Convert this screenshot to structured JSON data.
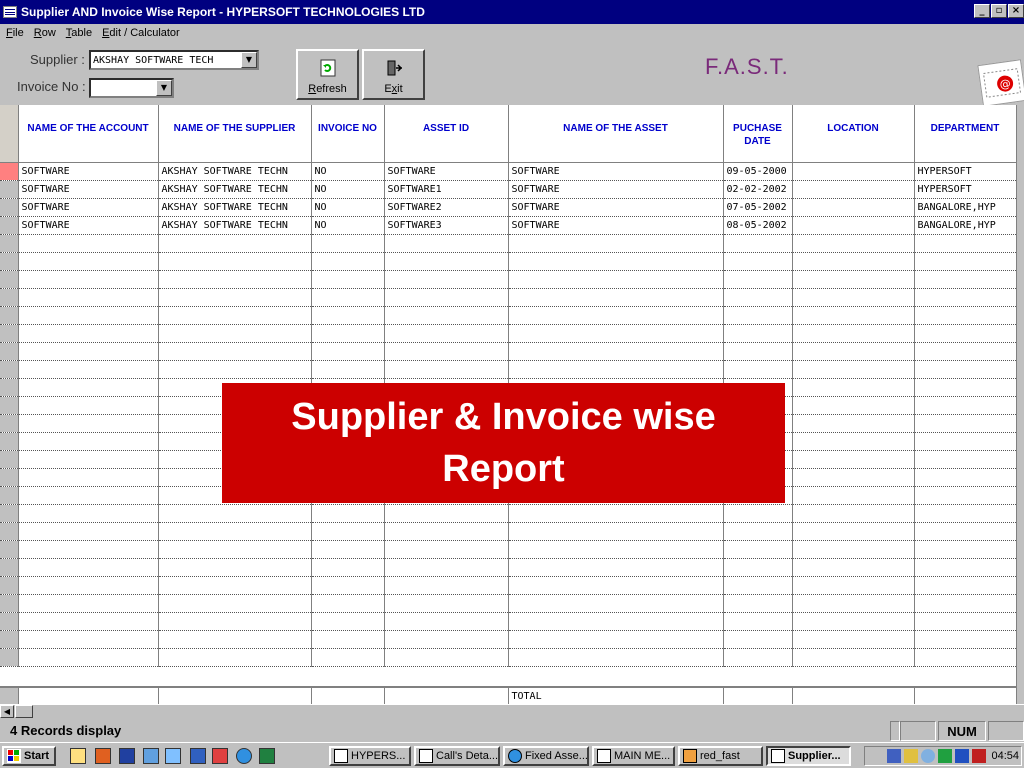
{
  "window": {
    "title": "Supplier AND Invoice Wise Report  -  HYPERSOFT TECHNOLOGIES LTD",
    "controls": [
      "_",
      "▫",
      "×"
    ]
  },
  "menu": [
    {
      "key": "F",
      "rest": "ile"
    },
    {
      "key": "R",
      "rest": "ow"
    },
    {
      "key": "T",
      "rest": "able"
    },
    {
      "key": "E",
      "rest": "dit / Calculator"
    }
  ],
  "filters": {
    "supplier_label": "Supplier :",
    "supplier_value": "AKSHAY SOFTWARE TECH",
    "invoice_label": "Invoice No :",
    "invoice_value": ""
  },
  "toolbar": {
    "refresh_key": "R",
    "refresh_rest": "efresh",
    "exit_pre": "E",
    "exit_key": "x",
    "exit_rest": "it"
  },
  "brand": "F.A.S.T.",
  "table": {
    "columns": [
      "NAME OF THE ACCOUNT",
      "NAME OF THE SUPPLIER",
      "INVOICE NO",
      "ASSET ID",
      "NAME OF THE ASSET",
      "PUCHASE DATE",
      "LOCATION",
      "DEPARTMENT"
    ],
    "rows": [
      [
        "SOFTWARE",
        "AKSHAY SOFTWARE TECHN",
        "NO",
        "SOFTWARE",
        "SOFTWARE",
        "09-05-2000",
        "",
        "HYPERSOFT"
      ],
      [
        "SOFTWARE",
        "AKSHAY SOFTWARE TECHN",
        "NO",
        "SOFTWARE1",
        "SOFTWARE",
        "02-02-2002",
        "",
        "HYPERSOFT"
      ],
      [
        "SOFTWARE",
        "AKSHAY SOFTWARE TECHN",
        "NO",
        "SOFTWARE2",
        "SOFTWARE",
        "07-05-2002",
        "",
        "BANGALORE,HYP"
      ],
      [
        "SOFTWARE",
        "AKSHAY SOFTWARE TECHN",
        "NO",
        "SOFTWARE3",
        "SOFTWARE",
        "08-05-2002",
        "",
        "BANGALORE,HYP"
      ]
    ],
    "empty_rows": 24,
    "total_label": "TOTAL"
  },
  "status": {
    "records": "4 Records display",
    "num": "NUM"
  },
  "taskbar": {
    "start": "Start",
    "tasks": [
      "HYPERS...",
      "Call's Deta...",
      "Fixed Asse...",
      "MAIN ME...",
      "red_fast",
      "Supplier..."
    ],
    "active_task": 5,
    "clock": "04:54"
  },
  "overlay": {
    "line1": "Supplier & Invoice wise",
    "line2": "Report"
  },
  "colors": {
    "titlebar": "#000080",
    "header_text": "#0000cc",
    "brand": "#7a2a7a",
    "overlay": "#cc0000"
  }
}
